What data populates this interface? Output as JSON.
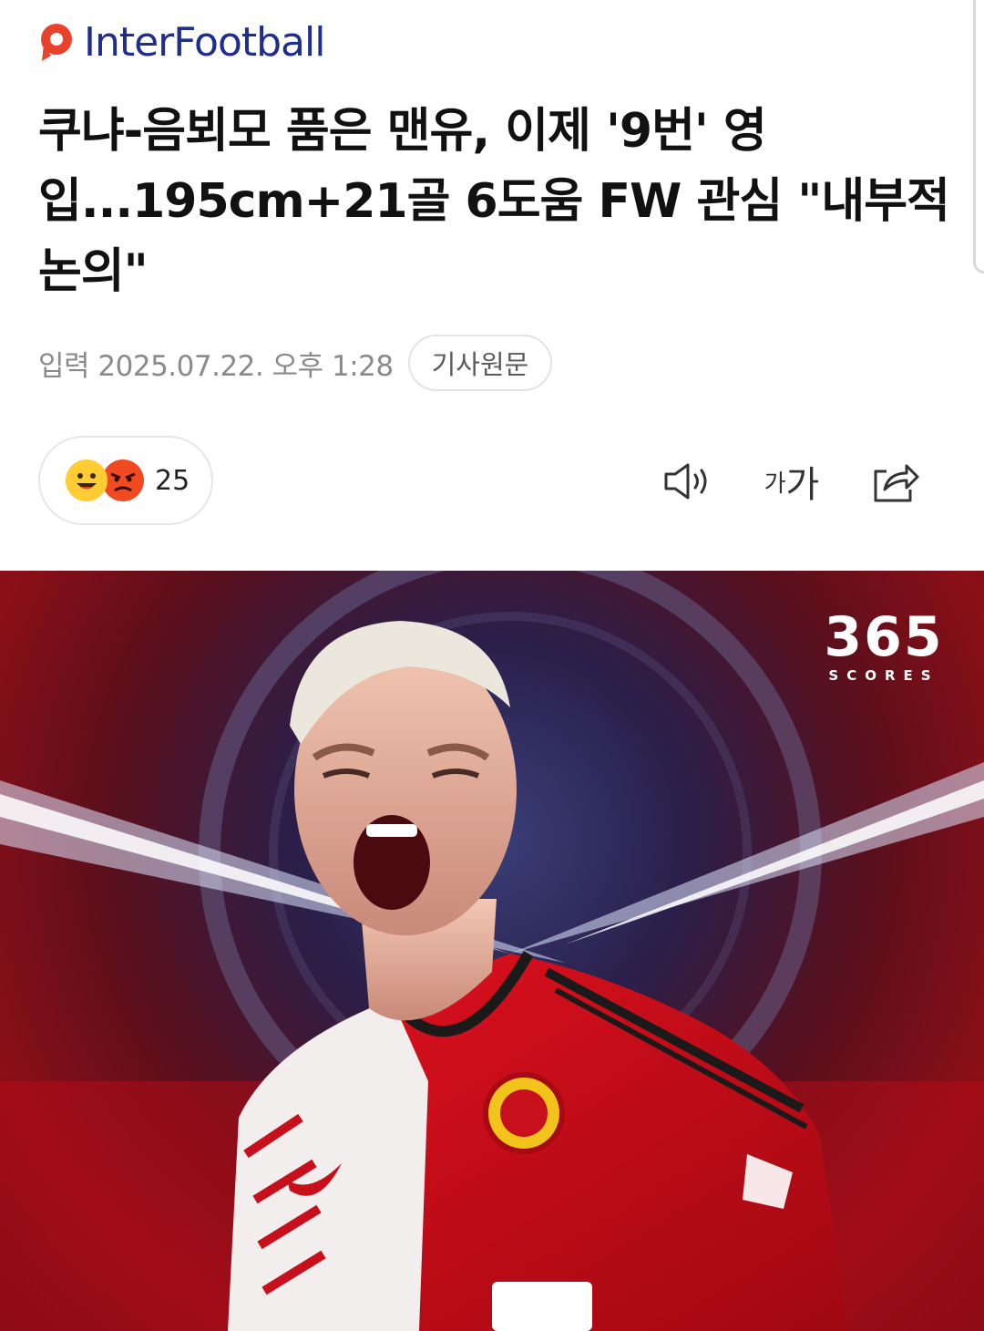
{
  "brand": {
    "name_part1": "Inter",
    "name_part2": "Football",
    "accent_color": "#e8432a",
    "text_color": "#1f2d8f"
  },
  "article": {
    "headline": "쿠냐-음뵈모 품은 맨유, 이제 '9번' 영입...195cm+21골 6도움 FW 관심 \"내부적 논의\"",
    "published_label": "입력 2025.07.22. 오후 1:28",
    "original_button": "기사원문"
  },
  "reactions": {
    "icons": [
      "happy-face-icon",
      "angry-face-icon"
    ],
    "count": "25"
  },
  "toolbar": {
    "listen_icon": "speaker-icon",
    "font_size_small": "가",
    "font_size_big": "가",
    "share_icon": "share-icon"
  },
  "hero_image": {
    "brand_big": "365",
    "brand_small": "SCORES",
    "colors": {
      "primary": "#c8101d",
      "dark": "#5e0a10",
      "accent": "#3a3f7a"
    }
  }
}
